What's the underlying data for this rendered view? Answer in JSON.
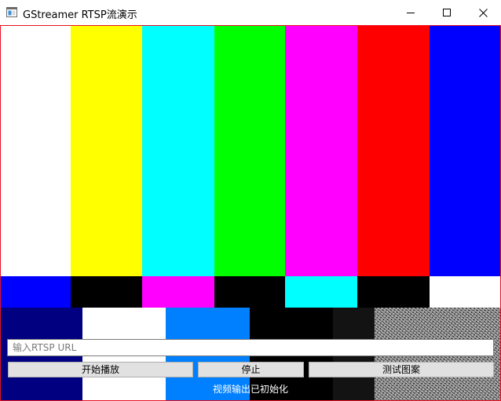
{
  "window": {
    "title": "GStreamer RTSP流演示",
    "icon": "app-window-icon",
    "controls": [
      "minimize-icon",
      "maximize-icon",
      "close-icon"
    ]
  },
  "test_pattern": {
    "top_bars": [
      "#ffffff",
      "#ffff00",
      "#00ffff",
      "#00ff00",
      "#ff00ff",
      "#ff0000",
      "#0000ff"
    ],
    "middle_bars": [
      "#0000ff",
      "#000000",
      "#ff00ff",
      "#000000",
      "#00ffff",
      "#000000",
      "#ffffff"
    ],
    "bottom_blocks": [
      "#000080",
      "#ffffff",
      "#0080ff",
      "#000000",
      "#131313",
      "noise"
    ]
  },
  "controls": {
    "url_input": {
      "placeholder": "输入RTSP URL",
      "value": ""
    },
    "play_label": "开始播放",
    "stop_label": "停止",
    "test_label": "测试图案"
  },
  "status": {
    "text": "视频输出已初始化"
  },
  "colors": {
    "frame_border": "#e81123",
    "button_bg": "#e1e1e1"
  }
}
